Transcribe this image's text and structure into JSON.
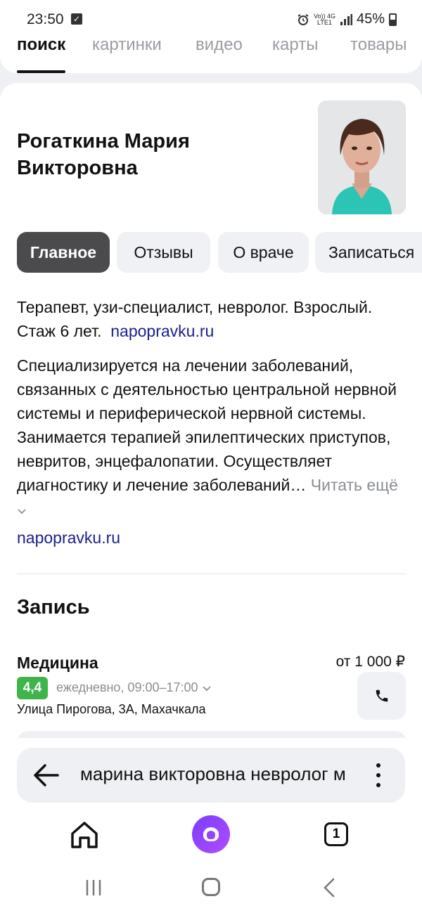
{
  "status_bar": {
    "time": "23:50",
    "net_top": "Vo)) 4G",
    "net_bottom": "LTE1",
    "battery": "45%"
  },
  "search_tabs": [
    "поиск",
    "картинки",
    "видео",
    "карты",
    "товары"
  ],
  "doctor": {
    "name": "Рогаткина Мария Викторовна",
    "specialty": "Терапевт, узи-специалист, невролог. Взрослый. Стаж 6 лет.",
    "source_link": "napopravku.ru",
    "description": "Специализируется на лечении заболеваний, связанных с деятельностью центральной нервной системы и периферической нервной системы. Занимается терапией эпилептических приступов, невритов, энцефалопатии. Осуществляет диагностику и лечение заболеваний…",
    "read_more": "Читать ещё",
    "description_link": "napopravku.ru"
  },
  "chips": [
    "Главное",
    "Отзывы",
    "О враче",
    "Записаться"
  ],
  "booking": {
    "title": "Запись",
    "clinic": "Медицина",
    "price": "от 1 000 ₽",
    "rating": "4,4",
    "hours": "ежедневно, 09:00–17:00",
    "address": "Улица Пирогова, 3А, Махачкала"
  },
  "omnibox": {
    "query": "марина викторовна невролог м"
  },
  "bottom_nav": {
    "tabs_count": "1"
  },
  "colors": {
    "active_chip": "#4b4b4d",
    "link": "#1a1f8c",
    "rating": "#3fb44a",
    "alice": "#8a3cff"
  }
}
